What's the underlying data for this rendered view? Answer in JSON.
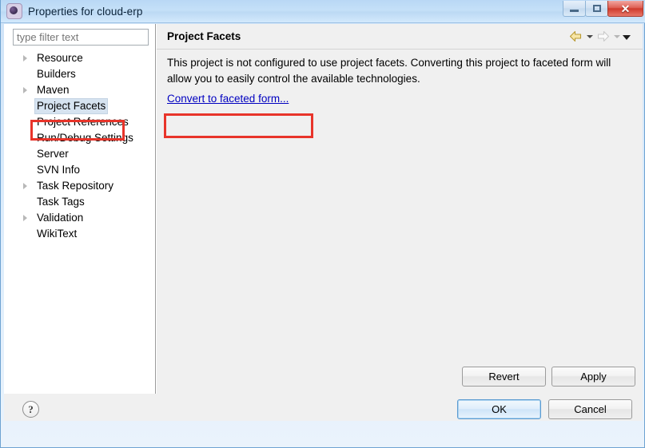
{
  "window": {
    "title": "Properties for cloud-erp",
    "icon": "eclipse-properties-icon",
    "controls": {
      "minimize_label": "–",
      "maximize_label": "□",
      "close_label": "✕"
    }
  },
  "sidebar": {
    "filter": {
      "placeholder": "type filter text",
      "value": ""
    },
    "items": [
      {
        "label": "Resource",
        "expandable": true,
        "selected": false
      },
      {
        "label": "Builders",
        "expandable": false,
        "selected": false
      },
      {
        "label": "Maven",
        "expandable": true,
        "selected": false
      },
      {
        "label": "Project Facets",
        "expandable": false,
        "selected": true
      },
      {
        "label": "Project References",
        "expandable": false,
        "selected": false
      },
      {
        "label": "Run/Debug Settings",
        "expandable": false,
        "selected": false
      },
      {
        "label": "Server",
        "expandable": false,
        "selected": false
      },
      {
        "label": "SVN Info",
        "expandable": false,
        "selected": false
      },
      {
        "label": "Task Repository",
        "expandable": true,
        "selected": false
      },
      {
        "label": "Task Tags",
        "expandable": false,
        "selected": false
      },
      {
        "label": "Validation",
        "expandable": true,
        "selected": false
      },
      {
        "label": "WikiText",
        "expandable": false,
        "selected": false
      }
    ]
  },
  "page": {
    "title": "Project Facets",
    "description": "This project is not configured to use project facets. Converting this project to faceted form will allow you to easily control the available technologies.",
    "link_label": "Convert to faceted form...",
    "nav": {
      "back_icon": "back-arrow-icon",
      "back_menu_icon": "chevron-down-icon",
      "forward_icon": "forward-arrow-icon",
      "forward_menu_icon": "chevron-down-icon",
      "view_menu_icon": "chevron-down-icon"
    },
    "buttons": {
      "revert_label": "Revert",
      "apply_label": "Apply"
    }
  },
  "footer": {
    "help_label": "?",
    "ok_label": "OK",
    "cancel_label": "Cancel"
  },
  "annotations": {
    "highlight_color": "#e8342a",
    "tree_highlight_target": "Project Facets",
    "link_highlight_target": "Convert to faceted form..."
  },
  "colors": {
    "link": "#0000c0",
    "titlebar": "#c5e0f8",
    "dialog_bg": "#f0f0f0",
    "selection": "#d6e3f0"
  }
}
